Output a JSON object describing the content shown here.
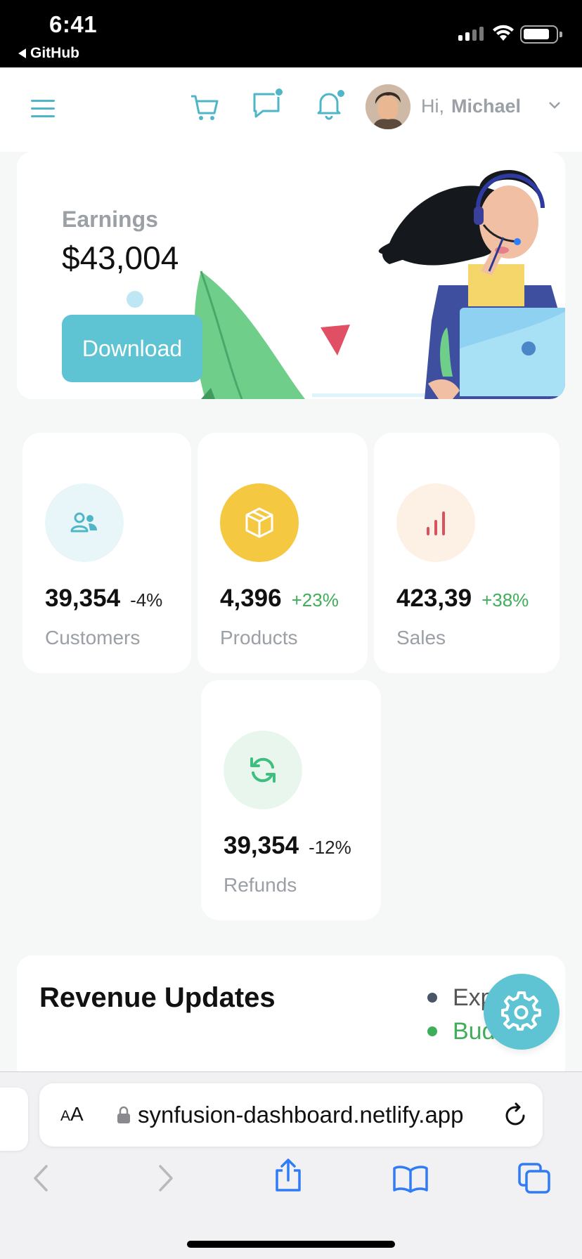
{
  "status_bar": {
    "time": "6:41",
    "back_app": "GitHub"
  },
  "header": {
    "greeting": "Hi,",
    "user_name": "Michael"
  },
  "earnings": {
    "label": "Earnings",
    "value": "$43,004",
    "download_label": "Download"
  },
  "stats": [
    {
      "value": "39,354",
      "change": "-4%",
      "label": "Customers",
      "trend": "neg",
      "icon": "customers-icon",
      "icon_bg": "#e8f6f9",
      "icon_color": "#4fb6c8"
    },
    {
      "value": "4,396",
      "change": "+23%",
      "label": "Products",
      "trend": "pos",
      "icon": "box-icon",
      "icon_bg": "#f5c842",
      "icon_color": "#ffffff"
    },
    {
      "value": "423,39",
      "change": "+38%",
      "label": "Sales",
      "trend": "pos",
      "icon": "bar-chart-icon",
      "icon_bg": "#fdf1e6",
      "icon_color": "#d9535f"
    },
    {
      "value": "39,354",
      "change": "-12%",
      "label": "Refunds",
      "trend": "neg",
      "icon": "refresh-icon",
      "icon_bg": "#e8f6ee",
      "icon_color": "#3fbf7f"
    }
  ],
  "revenue": {
    "title": "Revenue Updates",
    "legend": [
      {
        "label": "Exp",
        "color": "#4a5568"
      },
      {
        "label": "Bud",
        "color": "#3fae5a"
      }
    ]
  },
  "browser": {
    "text_size_label": "AA",
    "url": "synfusion-dashboard.netlify.app"
  },
  "colors": {
    "accent": "#5ec4d3",
    "positive": "#3fae5a"
  }
}
